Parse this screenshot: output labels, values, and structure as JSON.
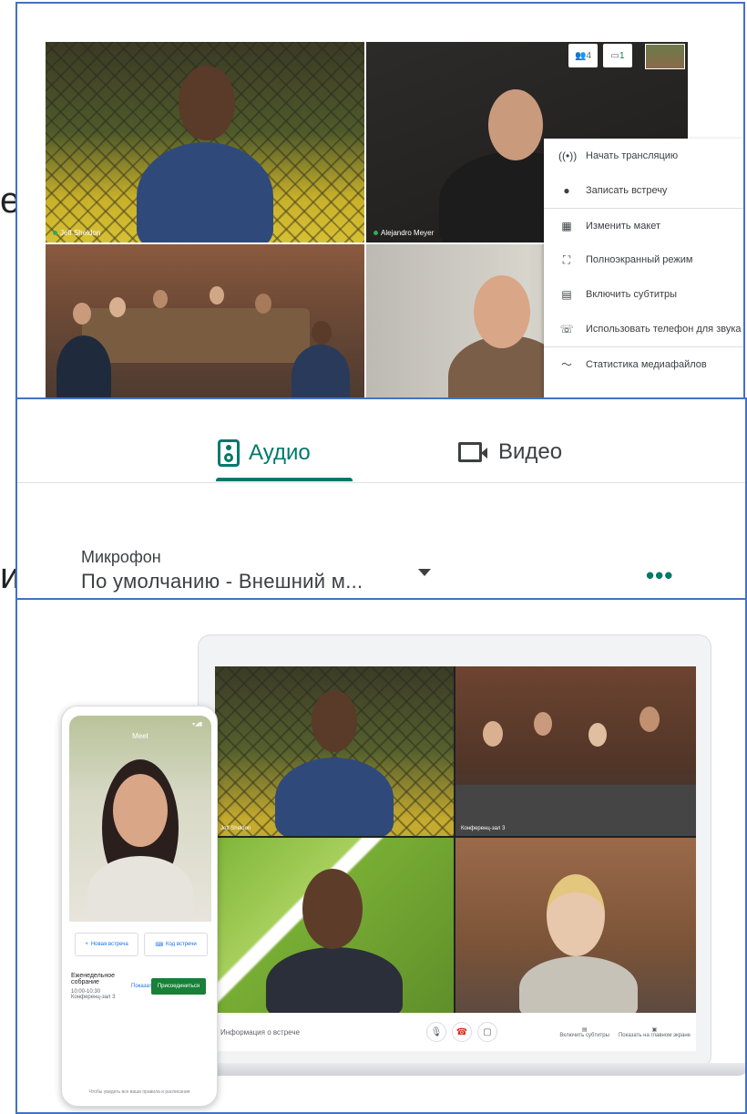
{
  "slide": {
    "letter_e": "е",
    "letter_i": "и"
  },
  "meet_grid": {
    "tiles": [
      {
        "name": "Jeff Sheldon"
      },
      {
        "name": "Alejandro Meyer"
      },
      {
        "name": ""
      },
      {
        "name": ""
      }
    ],
    "top_icons": {
      "people_count": "4",
      "chat_badge": "1"
    },
    "menu_items": [
      {
        "icon": "broadcast-icon",
        "glyph": "((•))",
        "label": "Начать трансляцию"
      },
      {
        "icon": "record-icon",
        "glyph": "●",
        "label": "Записать встречу"
      },
      {
        "icon": "layout-icon",
        "glyph": "▦",
        "label": "Изменить макет"
      },
      {
        "icon": "fullscreen-icon",
        "glyph": "⛶",
        "label": "Полноэкранный режим"
      },
      {
        "icon": "captions-icon",
        "glyph": "▤",
        "label": "Включить субтитры"
      },
      {
        "icon": "phone-audio-icon",
        "glyph": "☏",
        "label": "Использовать телефон для звука"
      },
      {
        "icon": "stats-icon",
        "glyph": "〜",
        "label": "Статистика медиафайлов"
      }
    ]
  },
  "settings": {
    "tabs": [
      {
        "label": "Аудио",
        "active": true
      },
      {
        "label": "Видео",
        "active": false
      }
    ],
    "microphone_label": "Микрофон",
    "microphone_value": "По умолчанию - Внешний м...",
    "accent_color": "#00796b"
  },
  "devices": {
    "laptop": {
      "tiles": [
        {
          "name": "Jeff Sheldon"
        },
        {
          "name": "Конференц-зал 3"
        },
        {
          "name": ""
        },
        {
          "name": ""
        }
      ],
      "meeting_info": "Информация о встрече",
      "captions_label": "Включить субтитры",
      "present_label": "Показать на главном экране"
    },
    "phone": {
      "app_title": "Meet",
      "new_meeting": "Новая встреча",
      "join_meeting": "Код встречи",
      "event_title": "Еженедельное собрание",
      "event_time": "10:00-10:30",
      "event_note": "Конференц-зал 3",
      "present_button": "Показать",
      "join_button": "Присоединиться",
      "footer": "Чтобы увидеть все ваши правила и расписания"
    }
  }
}
